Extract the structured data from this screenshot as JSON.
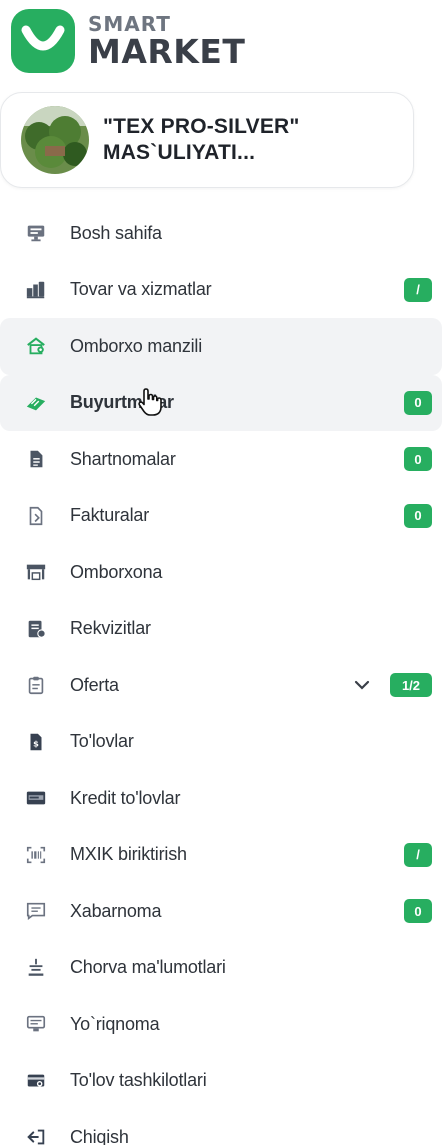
{
  "brand": {
    "line1": "SMART",
    "line2": "MARKET",
    "accent": "#27ae60"
  },
  "company": {
    "name": "\"TEX PRO-SILVER\" MAS`ULIYATI..."
  },
  "menu": {
    "items": [
      {
        "label": "Bosh sahifa",
        "icon": "monitor-icon",
        "badge": ""
      },
      {
        "label": "Tovar va xizmatlar",
        "icon": "goods-icon",
        "badge": "/"
      },
      {
        "label": "Omborxo manzili",
        "icon": "warehouse-address-icon",
        "badge": ""
      },
      {
        "label": "Buyurtmalar",
        "icon": "orders-icon",
        "badge": "0"
      },
      {
        "label": "Shartnomalar",
        "icon": "document-icon",
        "badge": "0"
      },
      {
        "label": "Fakturalar",
        "icon": "invoice-icon",
        "badge": "0"
      },
      {
        "label": "Omborxona",
        "icon": "store-icon",
        "badge": ""
      },
      {
        "label": "Rekvizitlar",
        "icon": "requisites-icon",
        "badge": ""
      },
      {
        "label": "Oferta",
        "icon": "clipboard-icon",
        "badge": "1/2"
      },
      {
        "label": "To'lovlar",
        "icon": "payments-icon",
        "badge": ""
      },
      {
        "label": "Kredit to'lovlar",
        "icon": "credit-card-icon",
        "badge": ""
      },
      {
        "label": "MXIK biriktirish",
        "icon": "scan-icon",
        "badge": "/"
      },
      {
        "label": "Xabarnoma",
        "icon": "message-icon",
        "badge": "0"
      },
      {
        "label": "Chorva ma'lumotlari",
        "icon": "livestock-icon",
        "badge": ""
      },
      {
        "label": "Yo`riqnoma",
        "icon": "guide-icon",
        "badge": ""
      },
      {
        "label": "To'lov tashkilotlari",
        "icon": "payment-orgs-icon",
        "badge": ""
      },
      {
        "label": "Chiqish",
        "icon": "logout-icon",
        "badge": ""
      }
    ]
  }
}
